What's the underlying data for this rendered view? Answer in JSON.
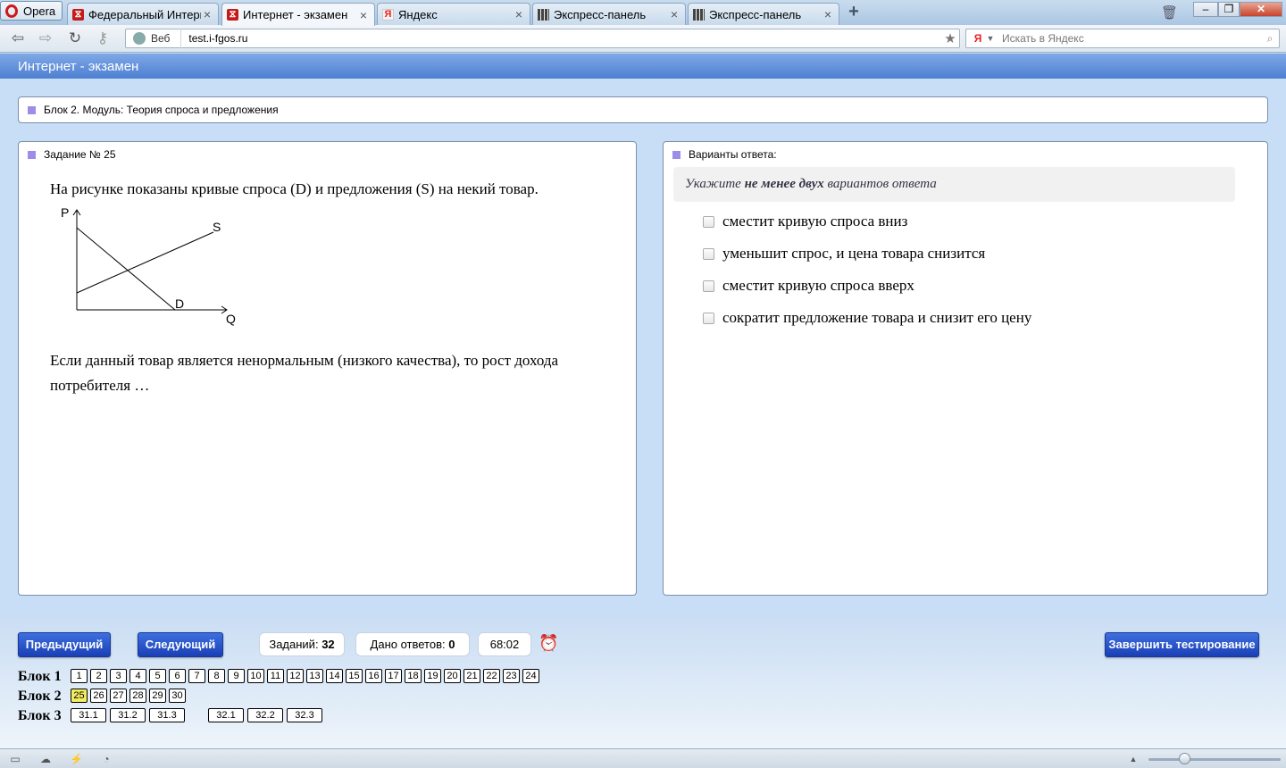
{
  "browser": {
    "menu_label": "Opera",
    "tabs": [
      {
        "title": "Федеральный Интерн…",
        "icon": "fgos-icon"
      },
      {
        "title": "Интернет - экзамен",
        "icon": "fgos-icon",
        "active": true
      },
      {
        "title": "Яндекс",
        "icon": "yandex-icon"
      },
      {
        "title": "Экспресс-панель",
        "icon": "speed-dial-icon"
      },
      {
        "title": "Экспресс-панель",
        "icon": "speed-dial-icon"
      }
    ],
    "tab_close": "×",
    "new_tab": "+",
    "address": {
      "scope": "Веб",
      "url": "test.i-fgos.ru"
    },
    "search": {
      "placeholder": "Искать в Яндекс",
      "engine": "Я"
    }
  },
  "app": {
    "title": "Интернет - экзамен",
    "block_header": "Блок 2. Модуль: Теория спроса и предложения",
    "task": {
      "title": "Задание № 25",
      "intro": "На рисунке показаны кривые спроса (D) и предложения (S) на некий товар.",
      "graph": {
        "axis_y": "P",
        "axis_x": "Q",
        "supply": "S",
        "demand": "D"
      },
      "question": "Если данный товар является ненормальным (низкого качества), то рост дохода потребителя …"
    },
    "answers": {
      "title": "Варианты ответа:",
      "hint_pre": "Укажите ",
      "hint_bold": "не менее двух",
      "hint_post": " вариантов ответа",
      "options": [
        "сместит кривую спроса вниз",
        "уменьшит спрос, и цена товара снизится",
        "сместит кривую спроса вверх",
        "сократит предложение товара и снизит его цену"
      ]
    },
    "nav": {
      "prev": "Предыдущий",
      "next": "Следующий",
      "finish": "Завершить тестирование",
      "tasks_label": "Заданий:",
      "tasks_count": "32",
      "answered_label": "Дано ответов:",
      "answered_count": "0",
      "timer": "68:02"
    },
    "blocks": [
      {
        "label": "Блок 1",
        "items": [
          "1",
          "2",
          "3",
          "4",
          "5",
          "6",
          "7",
          "8",
          "9",
          "10",
          "11",
          "12",
          "13",
          "14",
          "15",
          "16",
          "17",
          "18",
          "19",
          "20",
          "21",
          "22",
          "23",
          "24"
        ]
      },
      {
        "label": "Блок 2",
        "items": [
          "25",
          "26",
          "27",
          "28",
          "29",
          "30"
        ],
        "current": "25"
      },
      {
        "label": "Блок 3",
        "items": [
          "31.1",
          "31.2",
          "31.3",
          "32.1",
          "32.2",
          "32.3"
        ]
      }
    ]
  }
}
